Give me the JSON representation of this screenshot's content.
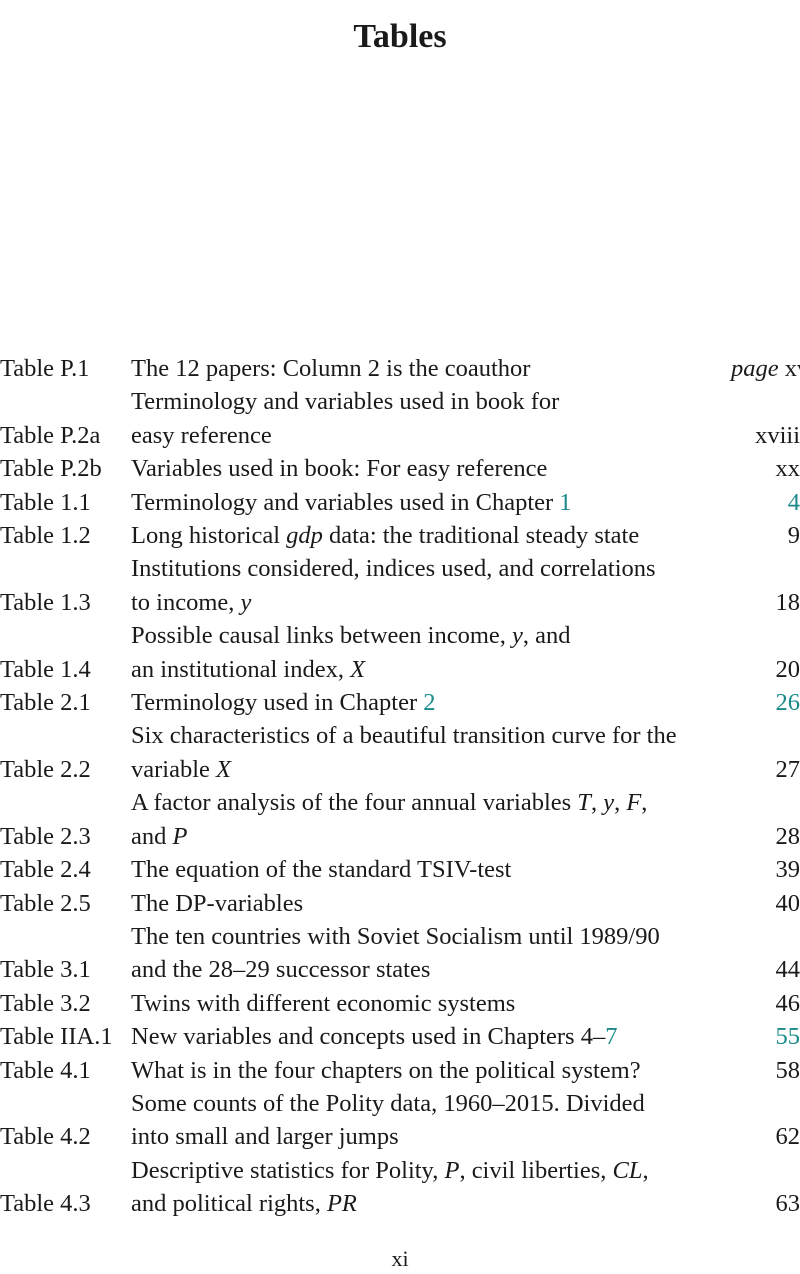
{
  "page_title": "Tables",
  "link_color": "#1a8a8a",
  "entries": [
    {
      "label": "Table P.1",
      "lines": [
        [
          {
            "t": "The 12 papers: Column 2 is the coauthor"
          }
        ]
      ],
      "page_prefix": "page",
      "page": "xvi",
      "page_is_link": false
    },
    {
      "label": "Table P.2a",
      "lines": [
        [
          {
            "t": "Terminology and variables used in book for"
          }
        ],
        [
          {
            "t": "easy reference"
          }
        ]
      ],
      "page": "xviii",
      "page_is_link": false
    },
    {
      "label": "Table P.2b",
      "lines": [
        [
          {
            "t": "Variables used in book: For easy reference"
          }
        ]
      ],
      "page": "xx",
      "page_is_link": false
    },
    {
      "label": "Table 1.1",
      "lines": [
        [
          {
            "t": "Terminology and variables used in Chapter "
          },
          {
            "t": "1",
            "link": true
          }
        ]
      ],
      "page": "4",
      "page_is_link": true
    },
    {
      "label": "Table 1.2",
      "lines": [
        [
          {
            "t": "Long historical "
          },
          {
            "t": "gdp",
            "i": true
          },
          {
            "t": " data: the traditional steady state"
          }
        ]
      ],
      "page": "9",
      "page_is_link": false
    },
    {
      "label": "Table 1.3",
      "lines": [
        [
          {
            "t": "Institutions considered, indices used, and correlations"
          }
        ],
        [
          {
            "t": "to income, "
          },
          {
            "t": "y",
            "i": true
          }
        ]
      ],
      "page": "18",
      "page_is_link": false
    },
    {
      "label": "Table 1.4",
      "lines": [
        [
          {
            "t": "Possible causal links between income, "
          },
          {
            "t": "y",
            "i": true
          },
          {
            "t": ", and"
          }
        ],
        [
          {
            "t": "an institutional index, "
          },
          {
            "t": "X",
            "i": true
          }
        ]
      ],
      "page": "20",
      "page_is_link": false
    },
    {
      "label": "Table 2.1",
      "lines": [
        [
          {
            "t": "Terminology used in Chapter "
          },
          {
            "t": "2",
            "link": true
          }
        ]
      ],
      "page": "26",
      "page_is_link": true
    },
    {
      "label": "Table 2.2",
      "lines": [
        [
          {
            "t": "Six characteristics of a beautiful transition curve for the"
          }
        ],
        [
          {
            "t": "variable "
          },
          {
            "t": "X",
            "i": true
          }
        ]
      ],
      "page": "27",
      "page_is_link": false
    },
    {
      "label": "Table 2.3",
      "lines": [
        [
          {
            "t": "A factor analysis of the four annual variables "
          },
          {
            "t": "T",
            "i": true
          },
          {
            "t": ", "
          },
          {
            "t": "y",
            "i": true
          },
          {
            "t": ", "
          },
          {
            "t": "F",
            "i": true
          },
          {
            "t": ","
          }
        ],
        [
          {
            "t": "and "
          },
          {
            "t": "P",
            "i": true
          }
        ]
      ],
      "page": "28",
      "page_is_link": false
    },
    {
      "label": "Table 2.4",
      "lines": [
        [
          {
            "t": "The equation of the standard TSIV-test"
          }
        ]
      ],
      "page": "39",
      "page_is_link": false
    },
    {
      "label": "Table 2.5",
      "lines": [
        [
          {
            "t": "The DP-variables"
          }
        ]
      ],
      "page": "40",
      "page_is_link": false
    },
    {
      "label": "Table 3.1",
      "lines": [
        [
          {
            "t": "The ten countries with Soviet Socialism until 1989/90"
          }
        ],
        [
          {
            "t": "and the 28–29 successor states"
          }
        ]
      ],
      "page": "44",
      "page_is_link": false
    },
    {
      "label": "Table 3.2",
      "lines": [
        [
          {
            "t": "Twins with different economic systems"
          }
        ]
      ],
      "page": "46",
      "page_is_link": false
    },
    {
      "label": "Table IIA.1",
      "lines": [
        [
          {
            "t": "New variables and concepts used in Chapters "
          },
          {
            "t": "4",
            "link": false
          },
          {
            "t": "–"
          },
          {
            "t": "7",
            "link": true
          }
        ]
      ],
      "page": "55",
      "page_is_link": true
    },
    {
      "label": "Table 4.1",
      "lines": [
        [
          {
            "t": "What is in the four chapters on the political system?"
          }
        ]
      ],
      "page": "58",
      "page_is_link": false
    },
    {
      "label": "Table 4.2",
      "lines": [
        [
          {
            "t": "Some counts of the Polity data, 1960–2015. Divided"
          }
        ],
        [
          {
            "t": "into small and larger jumps"
          }
        ]
      ],
      "page": "62",
      "page_is_link": false
    },
    {
      "label": "Table 4.3",
      "lines": [
        [
          {
            "t": "Descriptive statistics for Polity, "
          },
          {
            "t": "P",
            "i": true
          },
          {
            "t": ", civil liberties, "
          },
          {
            "t": "CL",
            "i": true
          },
          {
            "t": ","
          }
        ],
        [
          {
            "t": "and political rights, "
          },
          {
            "t": "PR",
            "i": true
          }
        ]
      ],
      "page": "63",
      "page_is_link": false
    }
  ],
  "folio": "xi"
}
